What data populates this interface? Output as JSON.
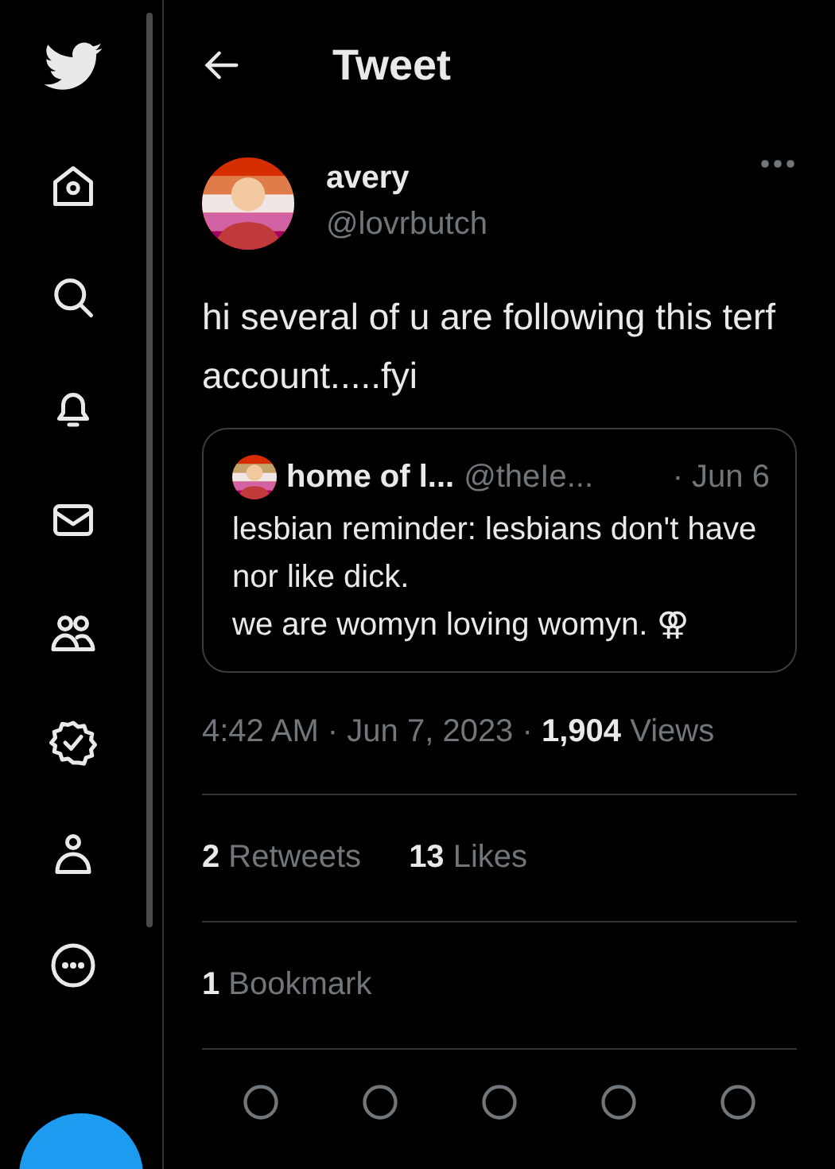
{
  "header": {
    "title": "Tweet"
  },
  "tweet": {
    "name": "avery",
    "handle": "@lovrbutch",
    "text": "hi several of u are following this terf account.....fyi",
    "quote": {
      "name": "home of l...",
      "handle": "@theIe...",
      "date": "· Jun 6",
      "text": "lesbian reminder: lesbians don't have nor like dick.\nwe are womyn loving womyn. ⚢"
    },
    "meta": "4:42 AM · Jun 7, 2023 · **1,904** Views",
    "stats": [
      "**2** Retweets",
      "**13** Likes"
    ],
    "bookmarks": "**1** Bookmark"
  }
}
